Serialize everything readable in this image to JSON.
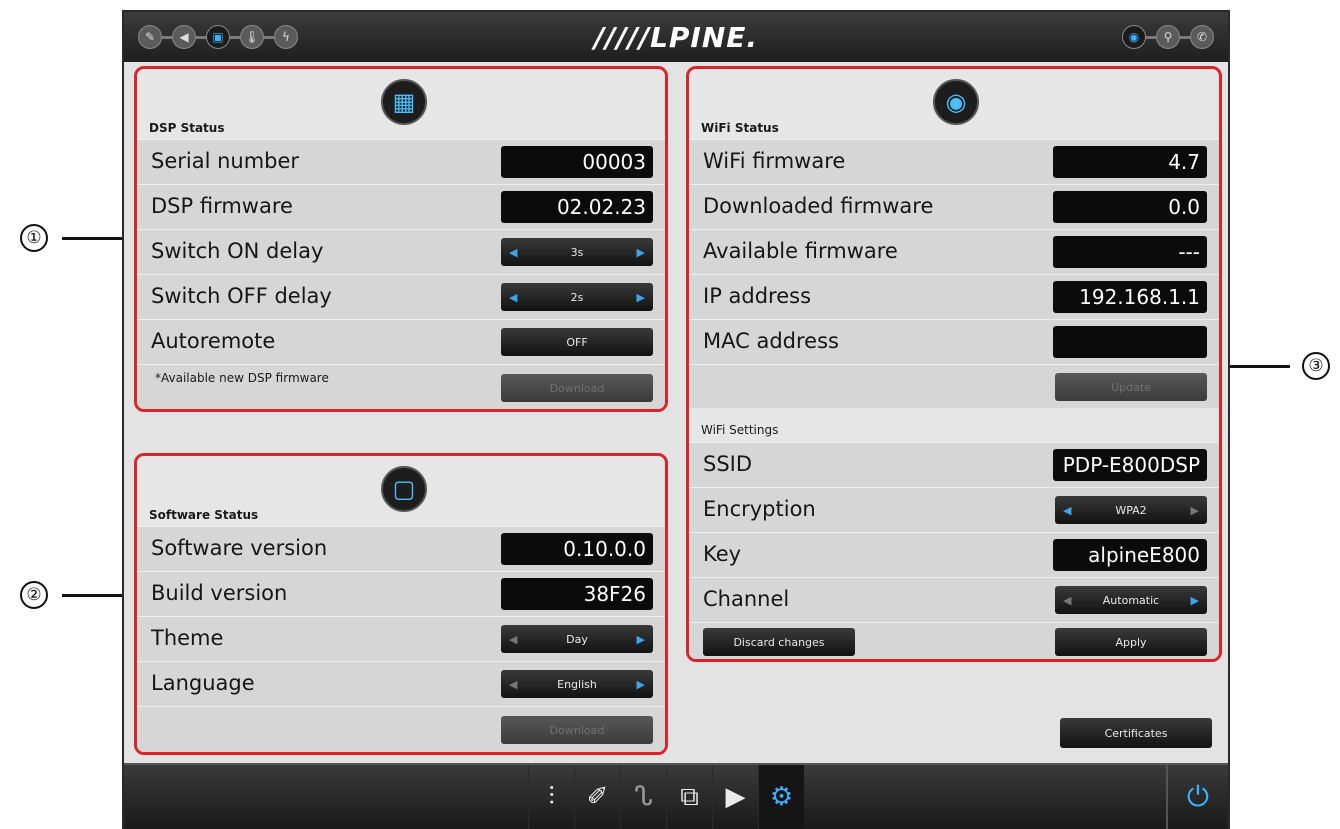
{
  "app": {
    "brand": "/////LPINE."
  },
  "topbar": {
    "left_icons": [
      "pencil-icon",
      "speaker-icon",
      "plug-icon",
      "thermometer-icon",
      "bolt-icon"
    ],
    "right_icons": [
      "wifi-icon",
      "usb-icon",
      "phone-icon"
    ]
  },
  "dsp": {
    "title": "DSP Status",
    "serial_label": "Serial number",
    "serial_value": "00003",
    "firmware_label": "DSP firmware",
    "firmware_value": "02.02.23",
    "on_delay_label": "Switch ON delay",
    "on_delay_value": "3s",
    "off_delay_label": "Switch OFF delay",
    "off_delay_value": "2s",
    "autoremote_label": "Autoremote",
    "autoremote_value": "OFF",
    "note": "*Available new DSP firmware",
    "download_label": "Download"
  },
  "software": {
    "title": "Software Status",
    "version_label": "Software version",
    "version_value": "0.10.0.0",
    "build_label": "Build version",
    "build_value": "38F26",
    "theme_label": "Theme",
    "theme_value": "Day",
    "language_label": "Language",
    "language_value": "English",
    "download_label": "Download"
  },
  "wifi": {
    "title": "WiFi Status",
    "firmware_label": "WiFi firmware",
    "firmware_value": "4.7",
    "downloaded_label": "Downloaded firmware",
    "downloaded_value": "0.0",
    "available_label": "Available firmware",
    "available_value": "---",
    "ip_label": "IP address",
    "ip_value": "192.168.1.1",
    "mac_label": "MAC address",
    "mac_value": "",
    "update_label": "Update",
    "settings_title": "WiFi Settings",
    "ssid_label": "SSID",
    "ssid_value": "PDP-E800DSP",
    "encryption_label": "Encryption",
    "encryption_value": "WPA2",
    "key_label": "Key",
    "key_value": "alpineE800",
    "channel_label": "Channel",
    "channel_value": "Automatic",
    "discard_label": "Discard changes",
    "apply_label": "Apply"
  },
  "certificates_label": "Certificates",
  "bottom_nav": [
    "equalizer-icon",
    "tools-icon",
    "curve-icon",
    "copy-icon",
    "play-icon",
    "gear-icon"
  ],
  "callouts": [
    "①",
    "②",
    "③"
  ],
  "colors": {
    "accent": "#3db0ff",
    "highlight": "#d9242c",
    "panel": "#e6e6e6",
    "value_bg": "#0b0b0b"
  }
}
